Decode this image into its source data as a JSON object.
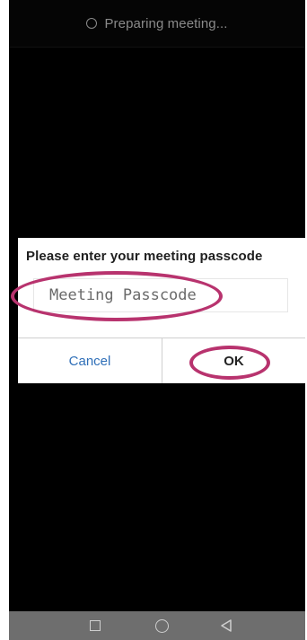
{
  "status_bar": {
    "text": "Preparing meeting...",
    "icon": "spinner-icon"
  },
  "dialog": {
    "title": "Please enter your meeting passcode",
    "passcode_input": {
      "placeholder": "Meeting Passcode",
      "value": ""
    },
    "cancel_label": "Cancel",
    "ok_label": "OK"
  },
  "annotations": {
    "highlight_color": "#b8336e"
  },
  "nav_bar": {
    "icons": [
      "recents-square-icon",
      "home-circle-icon",
      "back-triangle-icon"
    ]
  }
}
